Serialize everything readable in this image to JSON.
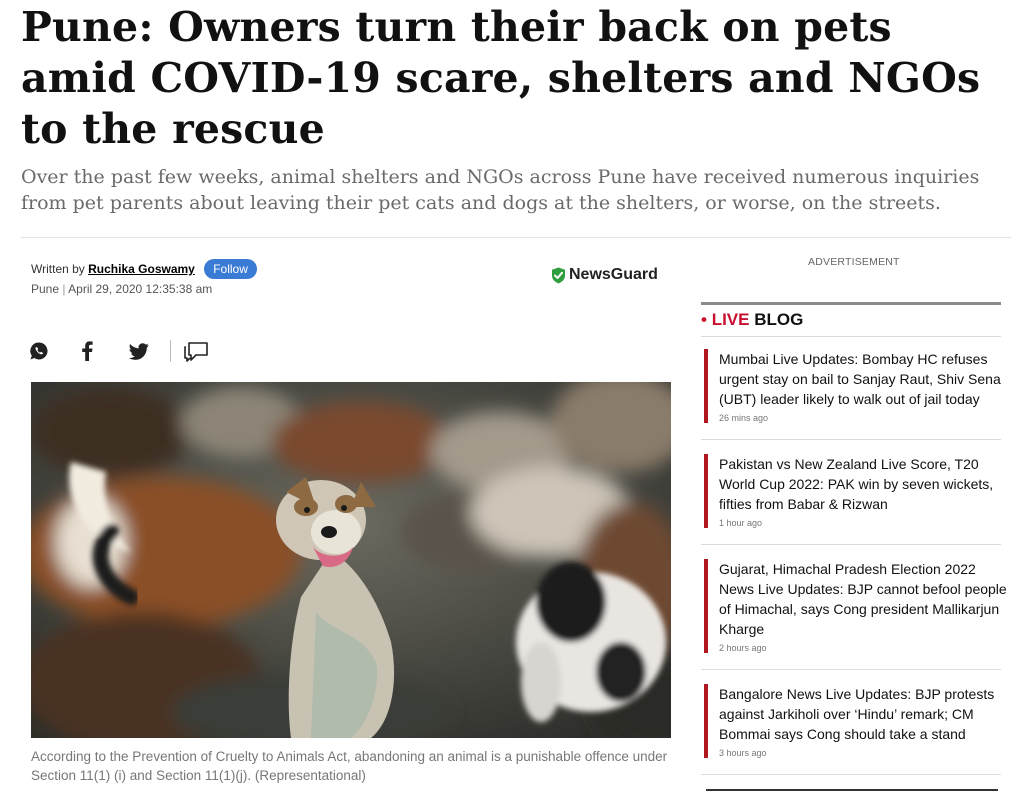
{
  "article": {
    "headline": "Pune: Owners turn their back on pets amid COVID-19 scare, shelters and NGOs to the rescue",
    "standfirst": "Over the past few weeks, animal shelters and NGOs across Pune have received numerous inquiries from pet parents about leaving their pet cats and dogs at the shelters, or worse, on the streets.",
    "byline_prefix": "Written by",
    "author": "Ruchika Goswamy",
    "follow_label": "Follow",
    "location": "Pune",
    "date_separator": "|",
    "date": "April 29, 2020 12:35:38 am",
    "newsguard_label": "NewsGuard",
    "caption": "According to the Prevention of Cruelty to Animals Act, abandoning an animal is a punishable offence under Section 11(1) (i) and Section 11(1)(j). (Representational)"
  },
  "share_icons": [
    "whatsapp-icon",
    "facebook-icon",
    "twitter-icon",
    "comment-icon"
  ],
  "sidebar": {
    "ad_label": "ADVERTISEMENT",
    "live_blog": {
      "dot": "•",
      "live_word": "LIVE",
      "blog_word": "BLOG",
      "items": [
        {
          "title": "Mumbai Live Updates: Bombay HC refuses urgent stay on bail to Sanjay Raut, Shiv Sena (UBT) leader likely to walk out of jail today",
          "time": "26 mins ago"
        },
        {
          "title": "Pakistan vs New Zealand Live Score, T20 World Cup 2022: PAK win by seven wickets, fifties from Babar & Rizwan",
          "time": "1 hour ago"
        },
        {
          "title": "Gujarat, Himachal Pradesh Election 2022 News Live Updates: BJP cannot befool people of Himachal, says Cong president Mallikarjun Kharge",
          "time": "2 hours ago"
        },
        {
          "title": "Bangalore News Live Updates: BJP protests against Jarkiholi over ‘Hindu’ remark; CM Bommai says Cong should take a stand",
          "time": "3 hours ago"
        }
      ]
    }
  },
  "colors": {
    "accent_red": "#c8102e",
    "follow_blue": "#3a7bd5",
    "newsguard_green": "#2e9e3e"
  }
}
